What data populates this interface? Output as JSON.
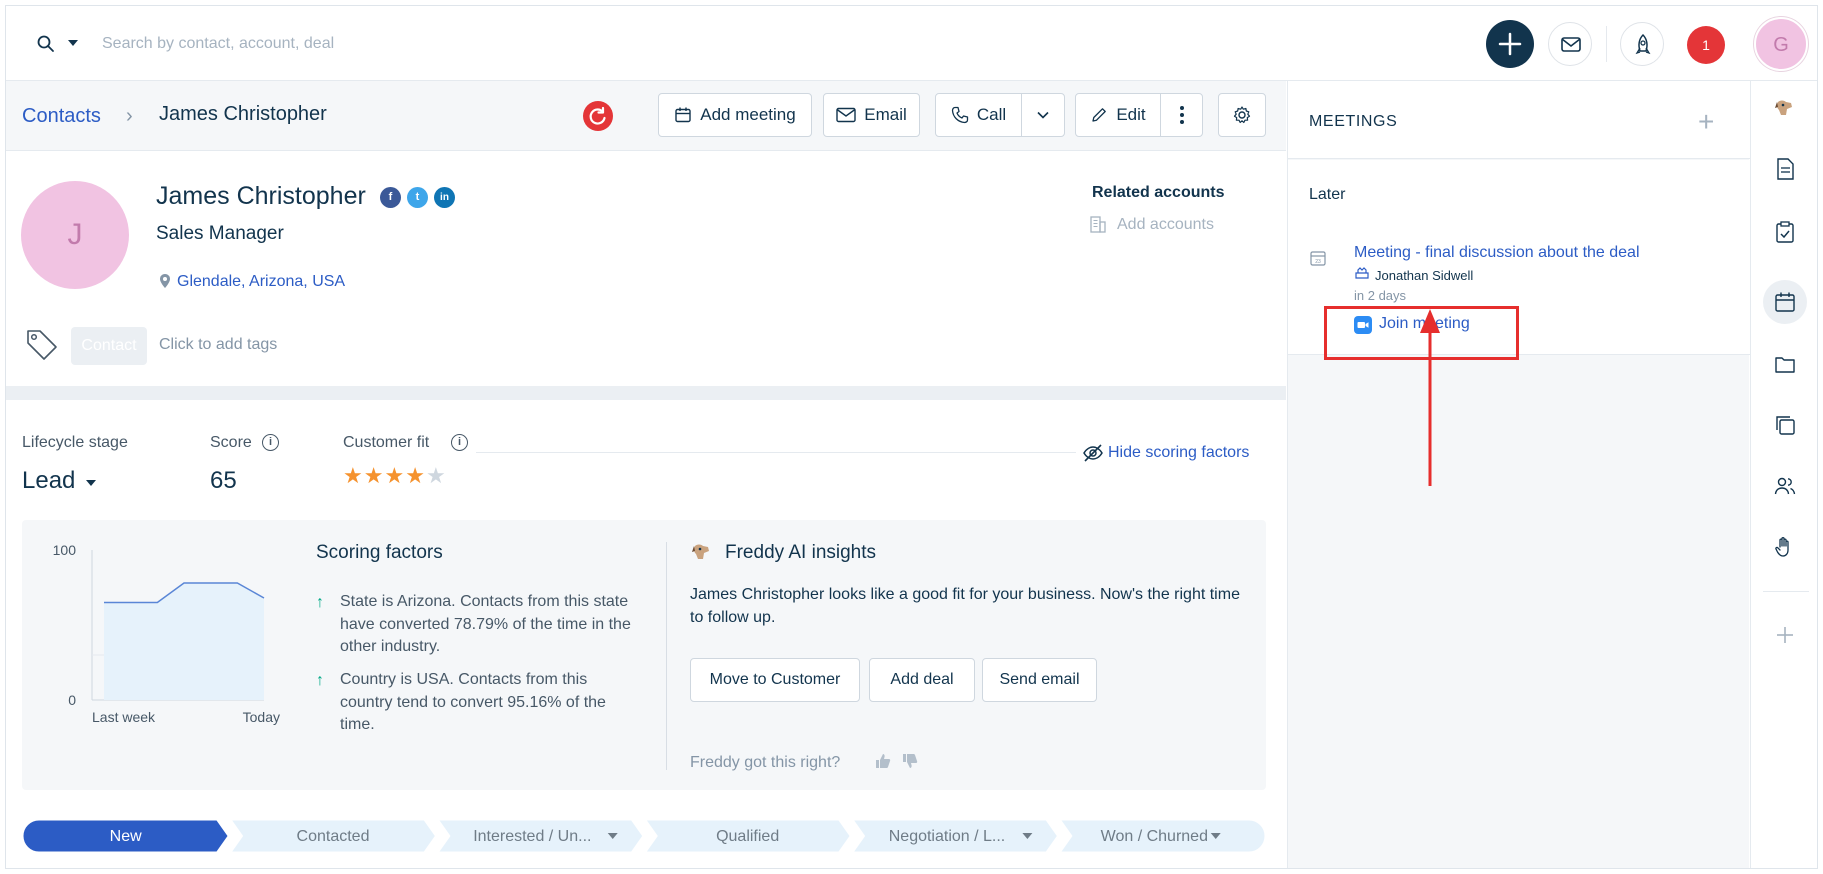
{
  "search": {
    "placeholder": "Search by contact, account, deal"
  },
  "topbar": {
    "notification_count": "1",
    "user_initial": "G"
  },
  "breadcrumb": {
    "root": "Contacts",
    "separator": "›",
    "current": "James Christopher"
  },
  "actions": {
    "add_meeting": "Add meeting",
    "email": "Email",
    "call": "Call",
    "edit": "Edit"
  },
  "contact": {
    "initial": "J",
    "name": "James Christopher",
    "job_title": "Sales Manager",
    "location": "Glendale, Arizona, USA",
    "tag": "Contact",
    "tag_hint": "Click to add tags",
    "related_title": "Related accounts",
    "related_add": "Add accounts",
    "social": [
      "f",
      "t",
      "in"
    ]
  },
  "stats": {
    "lifecycle_label": "Lifecycle stage",
    "lifecycle_value": "Lead",
    "score_label": "Score",
    "score_value": "65",
    "fit_label": "Customer fit",
    "fit_stars": 4,
    "fit_max": 5,
    "hide_link": "Hide scoring factors"
  },
  "chart_data": {
    "type": "area",
    "x_tick_labels": [
      "Last week",
      "Today"
    ],
    "y_tick_labels": [
      "100",
      "0"
    ],
    "ylim": [
      0,
      100
    ],
    "values": [
      65,
      65,
      65,
      78,
      78,
      78,
      68
    ]
  },
  "scoring": {
    "title": "Scoring factors",
    "factors": [
      "State is Arizona. Contacts from this state have converted 78.79% of the time in the other industry.",
      "Country is USA. Contacts from this country tend to convert 95.16% of the time."
    ]
  },
  "freddy": {
    "title": "Freddy AI insights",
    "text": "James Christopher looks like a good fit for your business. Now's the right time to follow up.",
    "buttons": [
      "Move to Customer",
      "Add deal",
      "Send email"
    ],
    "feedback": "Freddy got this right?"
  },
  "pipeline": {
    "stages": [
      "New",
      "Contacted",
      "Interested / Un...",
      "Qualified",
      "Negotiation / L...",
      "Won / Churned"
    ],
    "active_index": 0,
    "dropdown_stages": [
      2,
      4,
      5
    ]
  },
  "meetings": {
    "title": "MEETINGS",
    "section": "Later",
    "meeting_title": "Meeting - final discussion about the deal",
    "owner": "Jonathan Sidwell",
    "when": "in 2 days",
    "join": "Join meeting"
  },
  "colors": {
    "brand_dark": "#12344d",
    "link": "#2c5cc5",
    "alert_red": "#e43538",
    "annotation_red": "#e62e2d",
    "pipeline_active": "#2c5cc5",
    "pipeline_inactive": "#e6f2fb",
    "star": "#f5922e"
  }
}
